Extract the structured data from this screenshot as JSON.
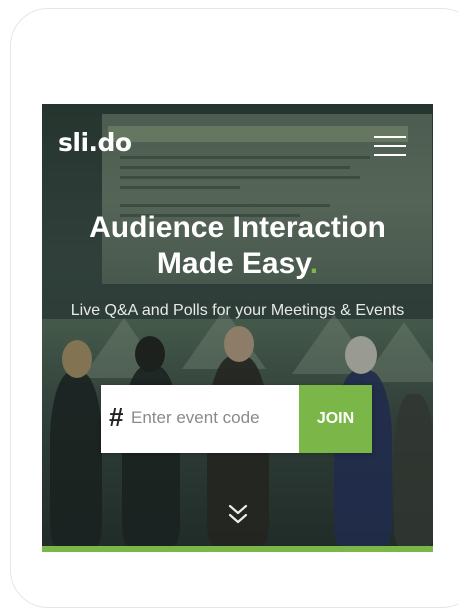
{
  "header": {
    "logo_text": "sli.do",
    "menu_icon": "hamburger-menu-icon"
  },
  "hero": {
    "headline_line1": "Audience Interaction",
    "headline_line2": "Made Easy",
    "headline_dot": ".",
    "subheadline": "Live Q&A and Polls for your Meetings & Events"
  },
  "join_form": {
    "hash_symbol": "#",
    "placeholder": "Enter event code",
    "value": "",
    "button_label": "JOIN"
  },
  "scroll_hint": {
    "icon": "double-chevron-down-icon"
  },
  "colors": {
    "accent": "#7ab648",
    "text_light": "#ffffff"
  }
}
